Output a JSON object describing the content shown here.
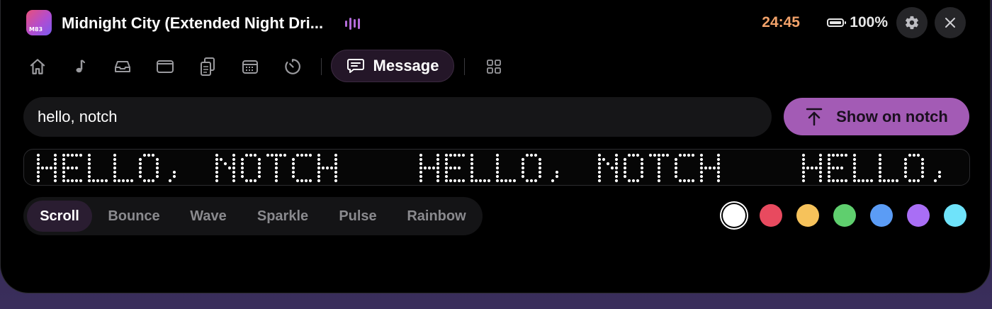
{
  "header": {
    "album_badge": "M83",
    "track_title": "Midnight City (Extended Night Dri...",
    "timer": "24:45",
    "battery_percent": "100%"
  },
  "nav": {
    "items": [
      "home-icon",
      "music-note-icon",
      "inbox-tray-icon",
      "window-icon",
      "clipboard-icon",
      "calendar-icon",
      "timer-icon"
    ],
    "active_label": "Message",
    "active_icon": "message-bubble-icon",
    "trailing_icon": "grid-icon"
  },
  "message": {
    "value": "hello, notch",
    "show_label": "Show on notch",
    "led_text": "HELLO, NOTCH"
  },
  "effects": {
    "tabs": [
      "Scroll",
      "Bounce",
      "Wave",
      "Sparkle",
      "Pulse",
      "Rainbow"
    ],
    "selected": "Scroll"
  },
  "colors": {
    "swatches": [
      "#ffffff",
      "#e84a5f",
      "#f6c25b",
      "#5fcf6e",
      "#5b9cf5",
      "#a96ef5",
      "#6fe3fa"
    ],
    "selected": "#ffffff",
    "accent": "#a35bb5",
    "timer": "#f2a26a"
  }
}
